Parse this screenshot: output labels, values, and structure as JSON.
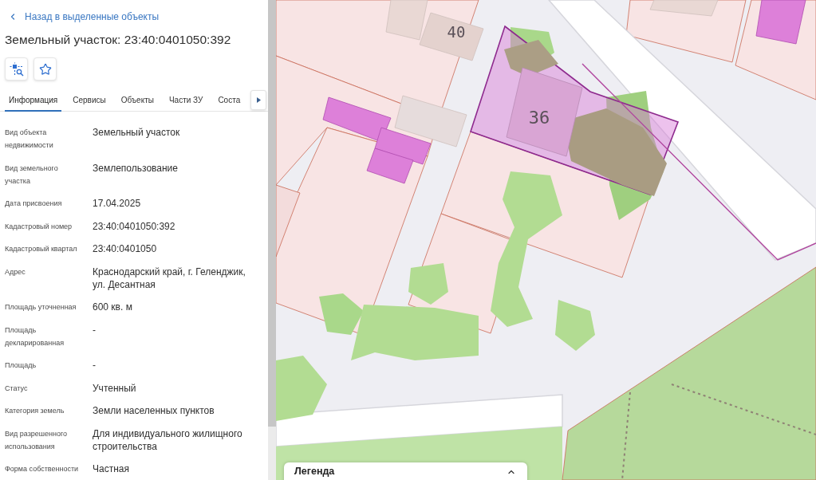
{
  "back_link": {
    "label": "Назад в выделенные объекты"
  },
  "title": "Земельный участок: 23:40:0401050:392",
  "tabs": [
    {
      "label": "Информация",
      "selected": true
    },
    {
      "label": "Сервисы",
      "selected": false
    },
    {
      "label": "Объекты",
      "selected": false
    },
    {
      "label": "Части ЗУ",
      "selected": false
    },
    {
      "label": "Соста",
      "selected": false
    }
  ],
  "fields": [
    {
      "label": "Вид объекта недвижимости",
      "value": "Земельный участок"
    },
    {
      "label": "Вид земельного участка",
      "value": "Землепользование"
    },
    {
      "label": "Дата присвоения",
      "value": "17.04.2025"
    },
    {
      "label": "Кадастровый номер",
      "value": "23:40:0401050:392"
    },
    {
      "label": "Кадастровый квартал",
      "value": "23:40:0401050"
    },
    {
      "label": "Адрес",
      "value": "Краснодарский край, г. Геленджик, ул. Десантная"
    },
    {
      "label": "Площадь уточненная",
      "value": "600 кв. м"
    },
    {
      "label": "Площадь декларированная",
      "value": "-"
    },
    {
      "label": "Площадь",
      "value": "-"
    },
    {
      "label": "Статус",
      "value": "Учтенный"
    },
    {
      "label": "Категория земель",
      "value": "Земли населенных пунктов"
    },
    {
      "label": "Вид разрешенного использования",
      "value": "Для индивидуального жилищного строительства"
    },
    {
      "label": "Форма собственности",
      "value": "Частная"
    }
  ],
  "map": {
    "house_numbers": [
      "40",
      "36"
    ],
    "legend": {
      "title": "Легенда"
    }
  }
}
